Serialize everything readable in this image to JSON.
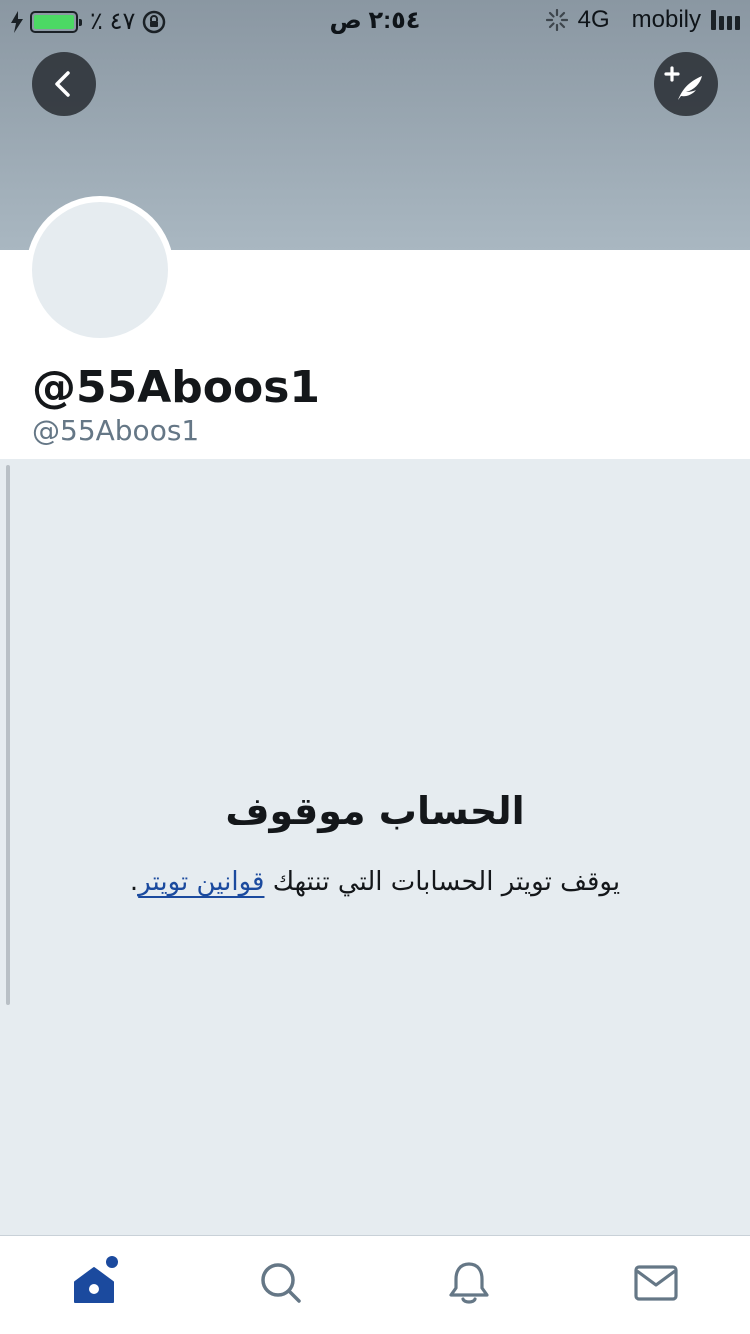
{
  "status_bar": {
    "battery_percent": "٪ ٤٧",
    "battery_level": 0.47,
    "time": "٢:٥٤ ص",
    "network": "4G",
    "carrier": "mobily"
  },
  "profile": {
    "display_name": "@55Aboos1",
    "handle": "@55Aboos1"
  },
  "suspended": {
    "title": "الحساب موقوف",
    "text_before": "يوقف تويتر الحسابات التي تنتهك ",
    "link_text": "قوانين تويتر",
    "text_after": "."
  },
  "tabs": [
    {
      "name": "home",
      "icon": "home-icon",
      "active": true
    },
    {
      "name": "search",
      "icon": "search-icon",
      "active": false
    },
    {
      "name": "notifications",
      "icon": "bell-icon",
      "active": false
    },
    {
      "name": "messages",
      "icon": "mail-icon",
      "active": false
    }
  ],
  "colors": {
    "accent": "#1b4a9e",
    "panel_bg": "#e6ecf0",
    "handle_gray": "#657786",
    "icon_gray": "#657786"
  }
}
